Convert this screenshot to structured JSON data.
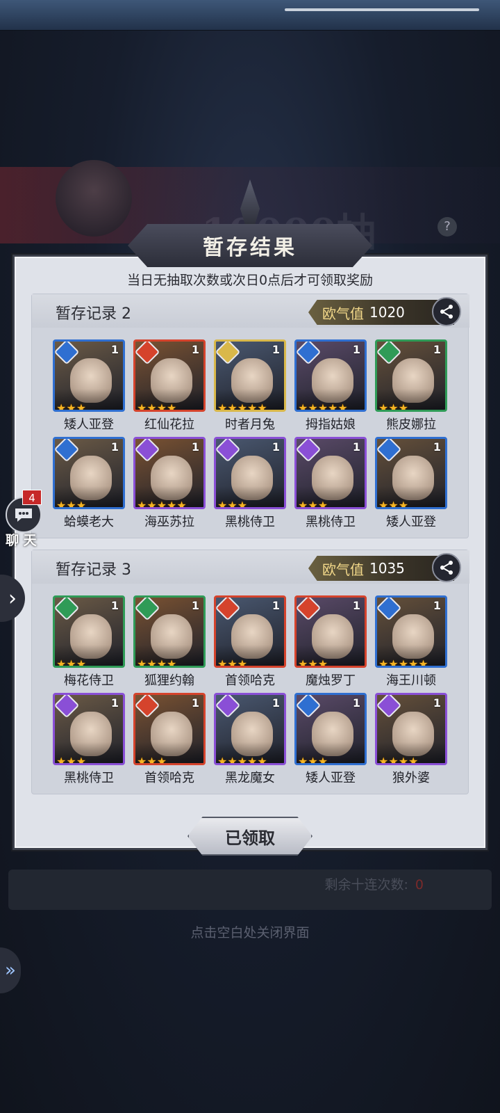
{
  "dialog": {
    "title": "暂存结果",
    "subtitle": "当日无抽取次数或次日0点后才可领取奖励",
    "claim_label": "已领取",
    "remaining_label": "剩余十连次数:",
    "remaining_value": "0",
    "close_hint": "点击空白处关闭界面"
  },
  "background": {
    "banner_text": "10000抽"
  },
  "chat": {
    "label": "聊 天",
    "badge": "4"
  },
  "luck_label": "欧气值",
  "records": [
    {
      "title": "暂存记录 2",
      "luck": "1020",
      "heroes": [
        {
          "name": "矮人亚登",
          "count": "1",
          "stars": 3,
          "element": "water"
        },
        {
          "name": "红仙花拉",
          "count": "1",
          "stars": 4,
          "element": "fire"
        },
        {
          "name": "时者月兔",
          "count": "1",
          "stars": 5,
          "element": "light"
        },
        {
          "name": "拇指姑娘",
          "count": "1",
          "stars": 5,
          "element": "water"
        },
        {
          "name": "熊皮娜拉",
          "count": "1",
          "stars": 3,
          "element": "wind"
        },
        {
          "name": "蛤蟆老大",
          "count": "1",
          "stars": 3,
          "element": "water"
        },
        {
          "name": "海巫苏拉",
          "count": "1",
          "stars": 5,
          "element": "dark"
        },
        {
          "name": "黑桃侍卫",
          "count": "1",
          "stars": 3,
          "element": "dark"
        },
        {
          "name": "黑桃侍卫",
          "count": "1",
          "stars": 3,
          "element": "dark"
        },
        {
          "name": "矮人亚登",
          "count": "1",
          "stars": 3,
          "element": "water"
        }
      ]
    },
    {
      "title": "暂存记录 3",
      "luck": "1035",
      "heroes": [
        {
          "name": "梅花侍卫",
          "count": "1",
          "stars": 3,
          "element": "wind"
        },
        {
          "name": "狐狸约翰",
          "count": "1",
          "stars": 4,
          "element": "wind"
        },
        {
          "name": "首领哈克",
          "count": "1",
          "stars": 3,
          "element": "fire"
        },
        {
          "name": "魔烛罗丁",
          "count": "1",
          "stars": 3,
          "element": "fire"
        },
        {
          "name": "海王川顿",
          "count": "1",
          "stars": 5,
          "element": "water"
        },
        {
          "name": "黑桃侍卫",
          "count": "1",
          "stars": 3,
          "element": "dark"
        },
        {
          "name": "首领哈克",
          "count": "1",
          "stars": 3,
          "element": "fire"
        },
        {
          "name": "黑龙魔女",
          "count": "1",
          "stars": 5,
          "element": "dark"
        },
        {
          "name": "矮人亚登",
          "count": "1",
          "stars": 3,
          "element": "water"
        },
        {
          "name": "狼外婆",
          "count": "1",
          "stars": 4,
          "element": "dark"
        }
      ]
    }
  ],
  "colors": {
    "water": "#2f6fd1",
    "fire": "#d5432c",
    "light": "#d9b84a",
    "wind": "#2f9b57",
    "dark": "#8a4fd6",
    "star": "#f5b423"
  }
}
